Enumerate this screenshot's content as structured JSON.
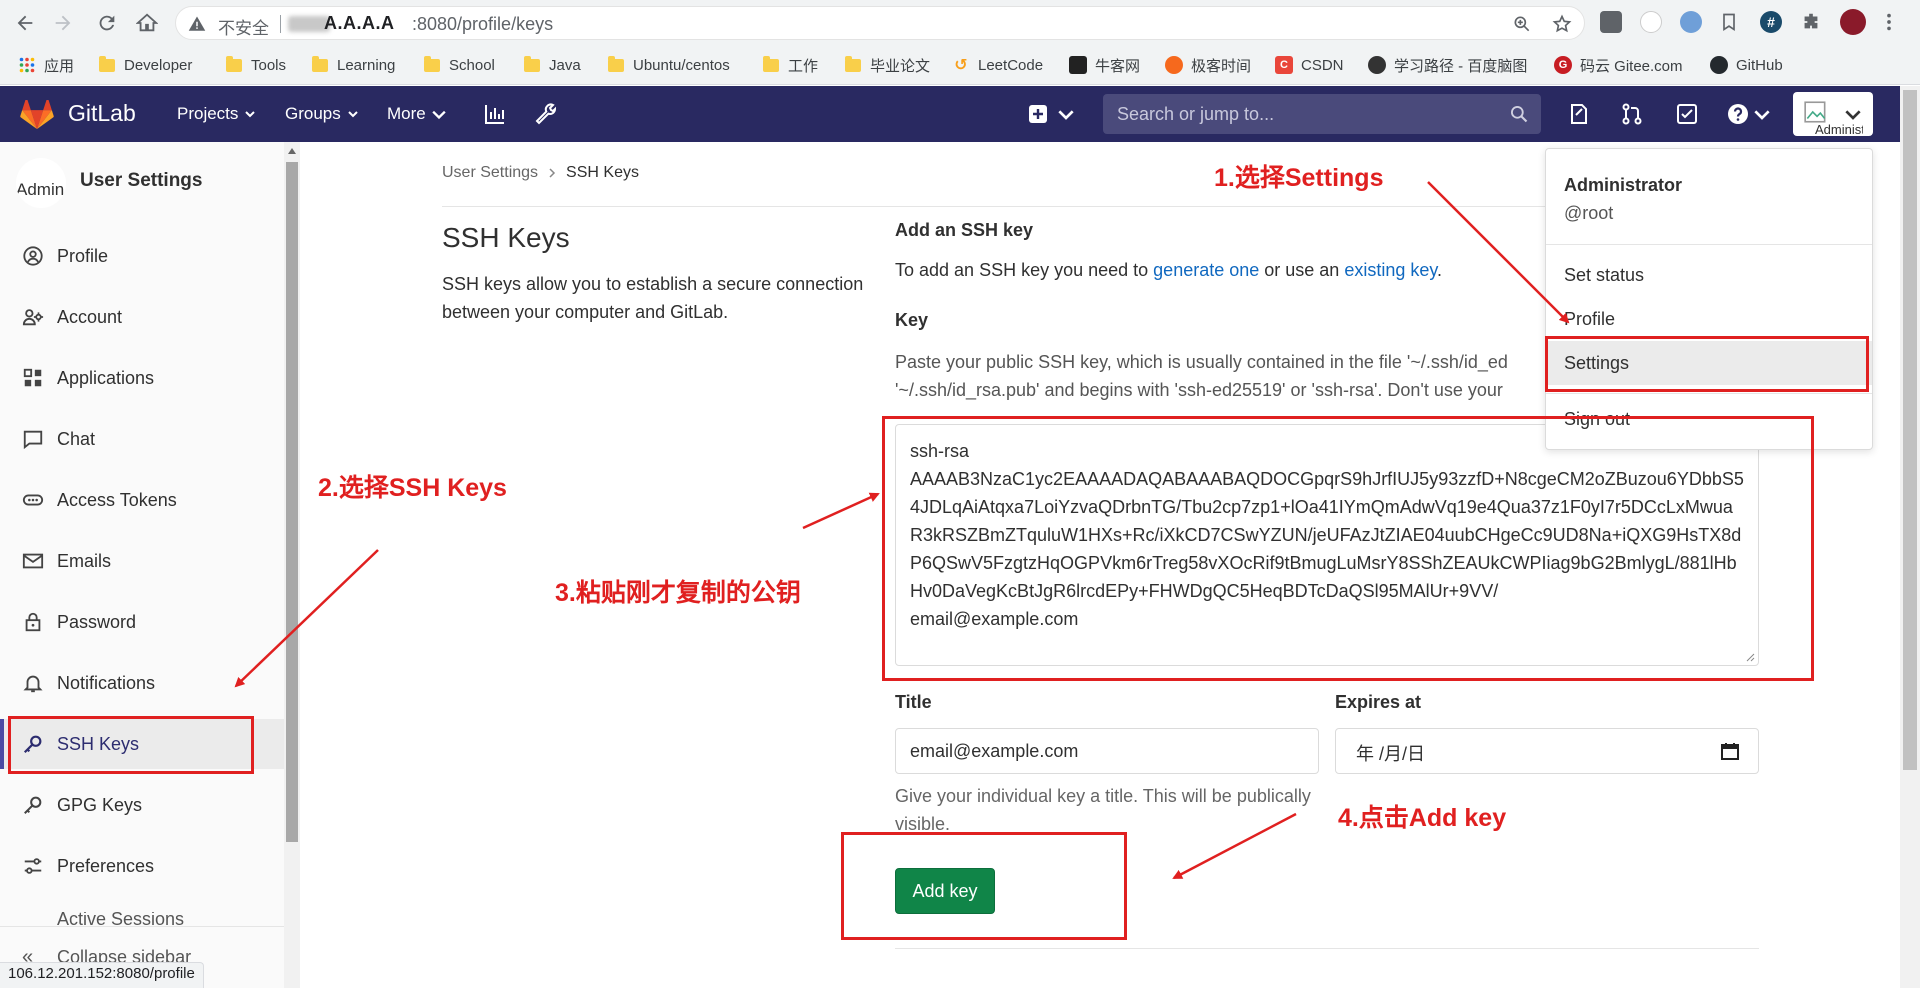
{
  "browser": {
    "insecure_label": "不安全",
    "host": "A.A.A.A",
    "path": ":8080/profile/keys",
    "status_url": "106.12.201.152:8080/profile"
  },
  "bookmarks": [
    {
      "label": "应用",
      "type": "apps"
    },
    {
      "label": "Developer",
      "type": "folder"
    },
    {
      "label": "Tools",
      "type": "folder"
    },
    {
      "label": "Learning",
      "type": "folder"
    },
    {
      "label": "School",
      "type": "folder"
    },
    {
      "label": "Java",
      "type": "folder"
    },
    {
      "label": "Ubuntu/centos",
      "type": "folder"
    },
    {
      "label": "工作",
      "type": "folder"
    },
    {
      "label": "毕业论文",
      "type": "folder"
    },
    {
      "label": "LeetCode",
      "type": "site"
    },
    {
      "label": "牛客网",
      "type": "site"
    },
    {
      "label": "极客时间",
      "type": "site"
    },
    {
      "label": "CSDN",
      "type": "site"
    },
    {
      "label": "学习路径 - 百度脑图",
      "type": "site"
    },
    {
      "label": "码云 Gitee.com",
      "type": "site"
    },
    {
      "label": "GitHub",
      "type": "site"
    }
  ],
  "gitlab": {
    "brand": "GitLab",
    "nav": [
      "Projects",
      "Groups",
      "More"
    ],
    "search_placeholder": "Search or jump to...",
    "avatar_alt": "Administrator",
    "colors": {
      "header": "#292961",
      "active_nav": "#4b4ba3",
      "button": "#108548",
      "link": "#1068bf"
    }
  },
  "sidebar": {
    "avatar_alt": "Admin",
    "title": "User Settings",
    "items": [
      {
        "label": "Profile",
        "icon": "profile-icon"
      },
      {
        "label": "Account",
        "icon": "account-icon"
      },
      {
        "label": "Applications",
        "icon": "applications-icon"
      },
      {
        "label": "Chat",
        "icon": "chat-icon"
      },
      {
        "label": "Access Tokens",
        "icon": "access-tokens-icon"
      },
      {
        "label": "Emails",
        "icon": "emails-icon"
      },
      {
        "label": "Password",
        "icon": "password-icon"
      },
      {
        "label": "Notifications",
        "icon": "notifications-icon"
      },
      {
        "label": "SSH Keys",
        "icon": "ssh-keys-icon",
        "active": true
      },
      {
        "label": "GPG Keys",
        "icon": "gpg-keys-icon"
      },
      {
        "label": "Preferences",
        "icon": "preferences-icon"
      }
    ],
    "partial_item": "Active Sessions",
    "collapse_label": "Collapse sidebar"
  },
  "main": {
    "breadcrumb": [
      "User Settings",
      "SSH Keys"
    ],
    "title": "SSH Keys",
    "description": "SSH keys allow you to establish a secure connection between your computer and GitLab.",
    "form_heading": "Add an SSH key",
    "intro_prefix": "To add an SSH key you need to ",
    "intro_link1": "generate one",
    "intro_middle": " or use an ",
    "intro_link2": "existing key",
    "intro_suffix": ".",
    "key_label": "Key",
    "key_help_line1": "Paste your public SSH key, which is usually contained in the file '~/.ssh/id_ed",
    "key_help_line2": "'~/.ssh/id_rsa.pub' and begins with 'ssh-ed25519' or 'ssh-rsa'. Don't use your",
    "key_value_line1": "ssh-rsa",
    "key_value_line2": "AAAAB3NzaC1yc2EAAAADAQABAAABAQDOCGpqrS9hJrfIUJ5y93zzfD+N8cgeCM2oZBuzou6YDbbS54JDLqAiAtqxa7LoiYzvaQDrbnTG/Tbu2cp7zp1+lOa41IYmQmAdwVq19e4Qua37z1F0yI7r5DCcLxMwuaR3kRSZBmZTquluW1HXs+Rc/iXkCD7CSwYZUN/jeUFAzJtZIAE04uubCHgeCc9UD8Na+iQXG9HsTX8dP6QSwV5FzgtzHqOGPVkm6rTreg58vXOcRif9tBmugLuMsrY8SShZEAUkCWPIiag9bG2BmlygL/881lHbHv0DaVegKcBtJgR6lrcdEPy+FHWDgQC5HeqBDTcDaQSl95MAlUr+9VV/",
    "key_value_line3": "email@example.com",
    "title_label": "Title",
    "title_value": "email@example.com",
    "expires_label": "Expires at",
    "expires_value": "年 /月/日",
    "title_help": "Give your individual key a title. This will be publically visible.",
    "add_button": "Add key"
  },
  "user_menu": {
    "name": "Administrator",
    "username": "@root",
    "items": [
      "Set status",
      "Profile",
      "Settings",
      "Sign out"
    ]
  },
  "annotations": {
    "step1": "1.选择Settings",
    "step2": "2.选择SSH Keys",
    "step3": "3.粘贴刚才复制的公钥",
    "step4": "4.点击Add key",
    "color": "#e02020"
  }
}
